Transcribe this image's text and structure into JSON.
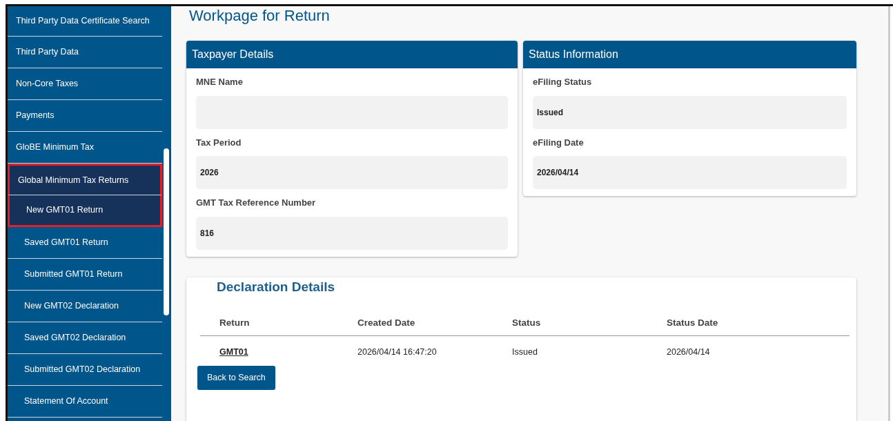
{
  "sidebar": {
    "items": [
      {
        "label": "Third Party Data Certificate Search",
        "selected": false
      },
      {
        "label": "Third Party Data",
        "selected": false
      },
      {
        "label": "Non-Core Taxes",
        "selected": false
      },
      {
        "label": "Payments",
        "selected": false
      },
      {
        "label": "GloBE Minimum Tax",
        "selected": false
      },
      {
        "label": "Global Minimum Tax Returns",
        "selected": true,
        "children": [
          {
            "label": "New GMT01 Return",
            "selected": true
          },
          {
            "label": "Saved GMT01 Return",
            "selected": false
          },
          {
            "label": "Submitted GMT01 Return",
            "selected": false
          },
          {
            "label": "New GMT02 Declaration",
            "selected": false
          },
          {
            "label": "Saved GMT02 Declaration",
            "selected": false
          },
          {
            "label": "Submitted GMT02 Declaration",
            "selected": false
          },
          {
            "label": "Statement Of Account",
            "selected": false
          }
        ]
      }
    ]
  },
  "page_title": "Workpage for Return",
  "panels": [
    {
      "title": "Taxpayer Details",
      "fields": [
        {
          "label": "MNE Name"
        },
        {
          "label": "Tax Period",
          "value": "2026"
        },
        {
          "label": "GMT Tax Reference Number",
          "value": "816"
        }
      ]
    },
    {
      "title": "Status Information",
      "fields": [
        {
          "label": "eFiling Status",
          "value": "Issued"
        },
        {
          "label": "eFiling Date",
          "value": "2026/04/14"
        }
      ]
    }
  ],
  "declaration": {
    "title": "Declaration Details",
    "columns": [
      "Return",
      "Created Date",
      "Status",
      "Status Date"
    ],
    "rows": [
      [
        "GMT01",
        "2026/04/14 16:47:20",
        "Issued",
        "2026/04/14"
      ]
    ],
    "back_button": "Back to Search"
  }
}
